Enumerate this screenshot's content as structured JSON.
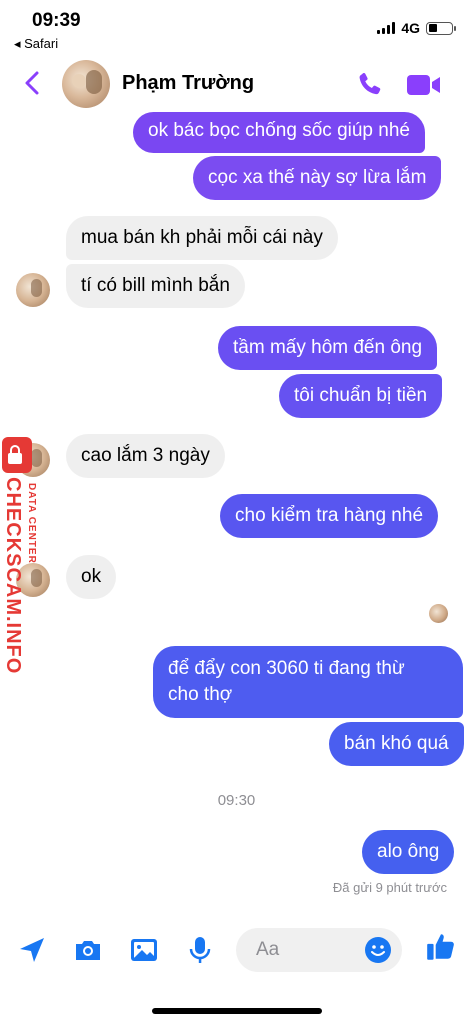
{
  "status_bar": {
    "time": "09:39",
    "back_app": "◂ Safari",
    "network": "4G",
    "battery_level": 0.4
  },
  "header": {
    "contact_name": "Phạm Trường"
  },
  "messages": [
    {
      "from": "me",
      "text": "ok bác bọc chống sốc giúp nhé"
    },
    {
      "from": "me",
      "text": "cọc xa thế này sợ lừa lắm"
    },
    {
      "from": "them",
      "text": "mua bán kh phải mỗi cái này"
    },
    {
      "from": "them",
      "text": "tí có bill mình bắn"
    },
    {
      "from": "me",
      "text": "tầm mấy hôm đến ông"
    },
    {
      "from": "me",
      "text": "tôi chuẩn bị tiền"
    },
    {
      "from": "them",
      "text": "cao lắm 3 ngày"
    },
    {
      "from": "me",
      "text": "cho kiểm tra hàng nhé"
    },
    {
      "from": "them",
      "text": "ok"
    },
    {
      "from": "me",
      "text": "để đẩy con 3060 ti đang thừ",
      "text2": "cho thợ"
    },
    {
      "from": "me",
      "text": "bán khó quá"
    },
    {
      "from": "me",
      "text": "alo ông"
    }
  ],
  "time_divider": "09:30",
  "sent_status": "Đã gửi 9 phút trước",
  "composer": {
    "placeholder": "Aa"
  },
  "watermark": {
    "main": "CHECKSCAM.INFO",
    "sub": "DATA CENTER"
  },
  "colors": {
    "accent": "#8a3ffc",
    "bubble_purple": "#7f47f2",
    "bubble_blue": "#4a5cf0",
    "bubble_incoming": "#efefef",
    "composer_icon": "#1877f2"
  }
}
